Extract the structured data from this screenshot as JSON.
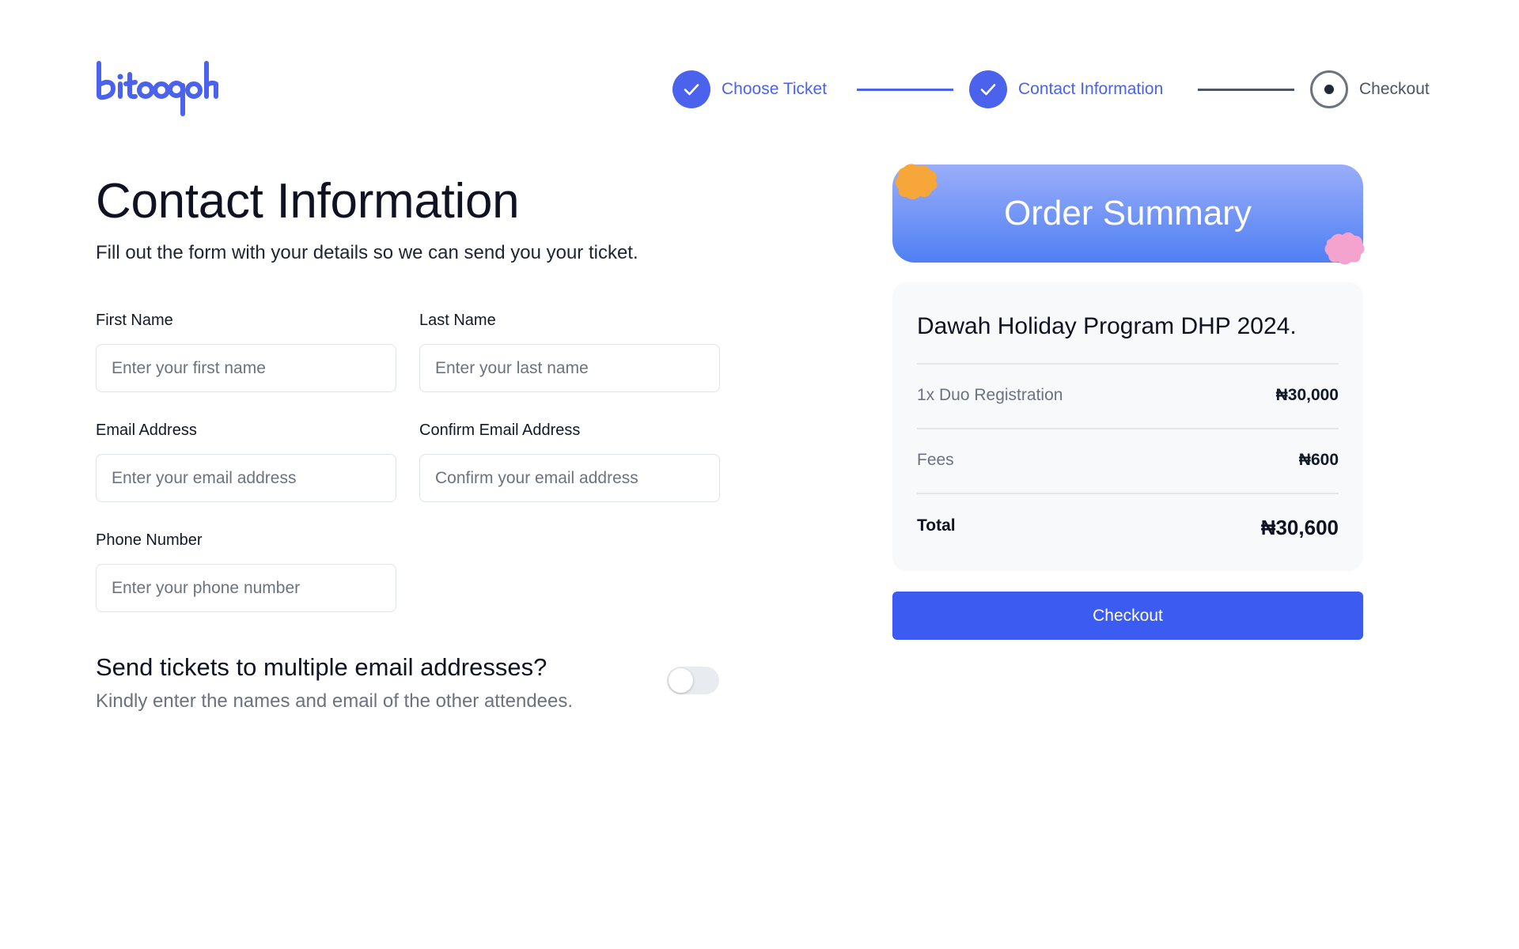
{
  "logo": {
    "text": "bitooqoh",
    "color": "#4b63ec"
  },
  "stepper": {
    "steps": [
      {
        "label": "Choose Ticket",
        "status": "done",
        "icon": "check-icon"
      },
      {
        "label": "Contact Information",
        "status": "done",
        "icon": "check-icon"
      },
      {
        "label": "Checkout",
        "status": "current",
        "icon": "dot-icon"
      }
    ],
    "accent": "#4b63ec"
  },
  "form": {
    "title": "Contact Information",
    "subtitle": "Fill out the form with your details so we can send you your ticket.",
    "first_name": {
      "label": "First Name",
      "placeholder": "Enter your first name",
      "value": ""
    },
    "last_name": {
      "label": "Last Name",
      "placeholder": "Enter your last name",
      "value": ""
    },
    "email": {
      "label": "Email Address",
      "placeholder": "Enter your email address",
      "value": ""
    },
    "confirm_email": {
      "label": "Confirm Email Address",
      "placeholder": "Confirm your email address",
      "value": ""
    },
    "phone": {
      "label": "Phone Number",
      "placeholder": "Enter your phone number",
      "value": ""
    },
    "multi_email": {
      "title": "Send tickets to multiple email addresses?",
      "subtitle": "Kindly enter the names and email of the other attendees.",
      "enabled": false
    }
  },
  "summary": {
    "header_title": "Order Summary",
    "event_title": "Dawah Holiday Program DHP 2024.",
    "rows": [
      {
        "label": "1x Duo Registration",
        "value": "₦30,000"
      },
      {
        "label": "Fees",
        "value": "₦600"
      }
    ],
    "total_label": "Total",
    "total_value": "₦30,600",
    "checkout_label": "Checkout",
    "button_color": "#3b5bf1"
  }
}
